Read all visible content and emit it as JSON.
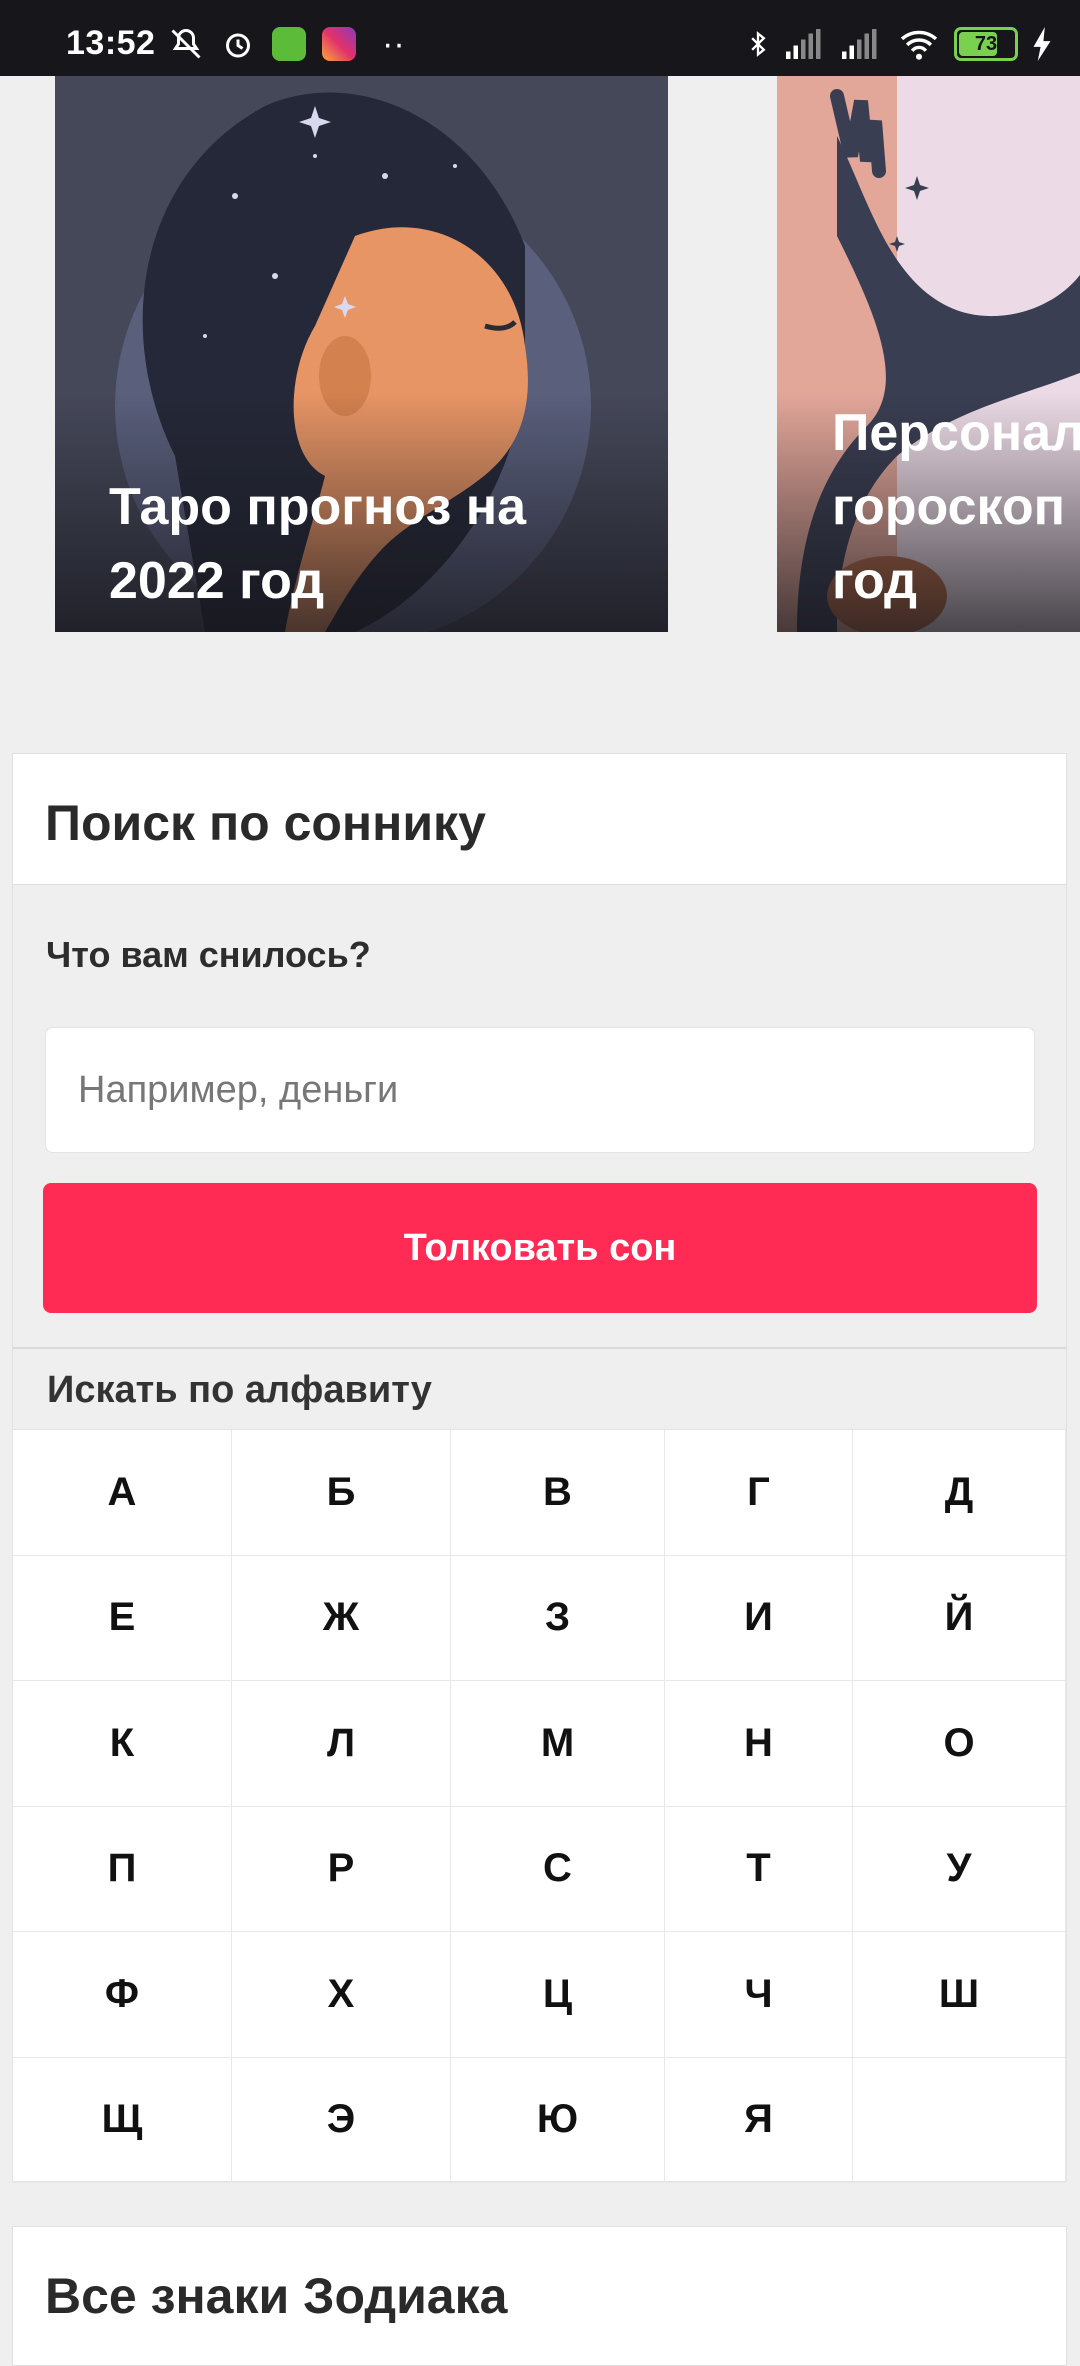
{
  "status_bar": {
    "time": "13:52",
    "battery": "73",
    "battery_level": 0.73,
    "icons": [
      "mute-icon",
      "alarm-icon",
      "app-icon-green",
      "instagram-icon",
      "more-dots",
      "bluetooth-icon",
      "signal-icon",
      "signal-icon",
      "wifi-icon",
      "battery-icon",
      "charging-icon"
    ]
  },
  "carousel": {
    "cards": [
      {
        "title": "Таро прогноз на\n2022 год"
      },
      {
        "title": "Персонал\nгороскоп\nгод"
      }
    ]
  },
  "dream_search": {
    "heading": "Поиск по соннику",
    "question": "Что вам снилось?",
    "placeholder": "Например, деньги",
    "button": "Толковать сон",
    "accent_color": "#ff2b55"
  },
  "alphabet": {
    "label": "Искать по алфавиту",
    "letters": [
      "А",
      "Б",
      "В",
      "Г",
      "Д",
      "Е",
      "Ж",
      "З",
      "И",
      "Й",
      "К",
      "Л",
      "М",
      "Н",
      "О",
      "П",
      "Р",
      "С",
      "Т",
      "У",
      "Ф",
      "Х",
      "Ц",
      "Ч",
      "Ш",
      "Щ",
      "Э",
      "Ю",
      "Я",
      ""
    ]
  },
  "zodiac": {
    "heading": "Все знаки Зодиака"
  }
}
